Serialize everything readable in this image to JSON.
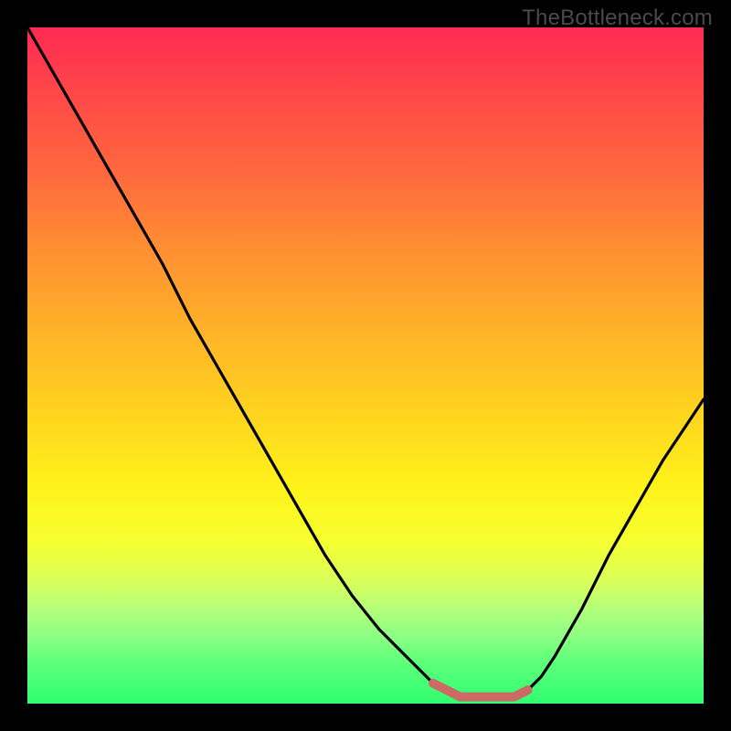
{
  "watermark": "TheBottleneck.com",
  "chart_data": {
    "type": "line",
    "title": "",
    "xlabel": "",
    "ylabel": "",
    "xlim": [
      0,
      100
    ],
    "ylim": [
      0,
      100
    ],
    "legend": false,
    "grid": false,
    "background_gradient": {
      "top": "#ff2a52",
      "mid": "#ffe11f",
      "bottom": "#2fff70"
    },
    "series": [
      {
        "name": "bottleneck-curve",
        "color": "#000000",
        "x": [
          0,
          4,
          8,
          12,
          16,
          20,
          24,
          28,
          32,
          36,
          40,
          44,
          48,
          52,
          56,
          60,
          62,
          64,
          66,
          68,
          70,
          72,
          74,
          76,
          78,
          82,
          86,
          90,
          94,
          98,
          100
        ],
        "y": [
          100,
          93,
          86,
          79,
          72,
          65,
          57,
          50,
          43,
          36,
          29,
          22,
          16,
          11,
          7,
          3,
          2,
          1,
          1,
          1,
          1,
          1,
          2,
          4,
          7,
          14,
          22,
          29,
          36,
          42,
          45
        ]
      }
    ],
    "marker_segment": {
      "name": "optimal-range",
      "color": "#cc6b66",
      "x": [
        60,
        62,
        64,
        66,
        68,
        70,
        72,
        74
      ],
      "y": [
        3,
        2,
        1,
        1,
        1,
        1,
        1,
        2
      ]
    }
  }
}
